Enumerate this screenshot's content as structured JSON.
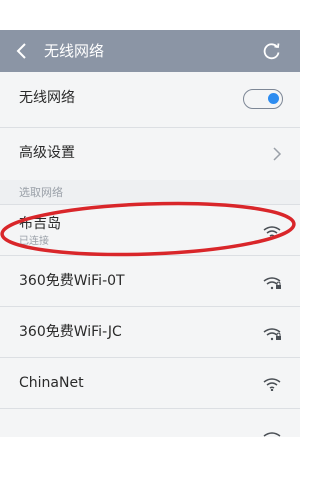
{
  "header": {
    "title": "无线网络",
    "back_icon": "back-arrow-icon",
    "refresh_icon": "refresh-icon",
    "bg_color": "#8b95a5"
  },
  "wlan": {
    "label": "无线网络",
    "toggle_on": true,
    "toggle_color": "#2d8cf0"
  },
  "advanced": {
    "label": "高级设置"
  },
  "networks_section": {
    "label": "选取网络"
  },
  "networks": [
    {
      "name": "布吉岛",
      "status": "已连接",
      "secured": false
    },
    {
      "name": "360免费WiFi-0T",
      "status": "",
      "secured": true
    },
    {
      "name": "360免费WiFi-JC",
      "status": "",
      "secured": true
    },
    {
      "name": "ChinaNet",
      "status": "",
      "secured": false
    }
  ],
  "annotation_color": "#d9262a"
}
